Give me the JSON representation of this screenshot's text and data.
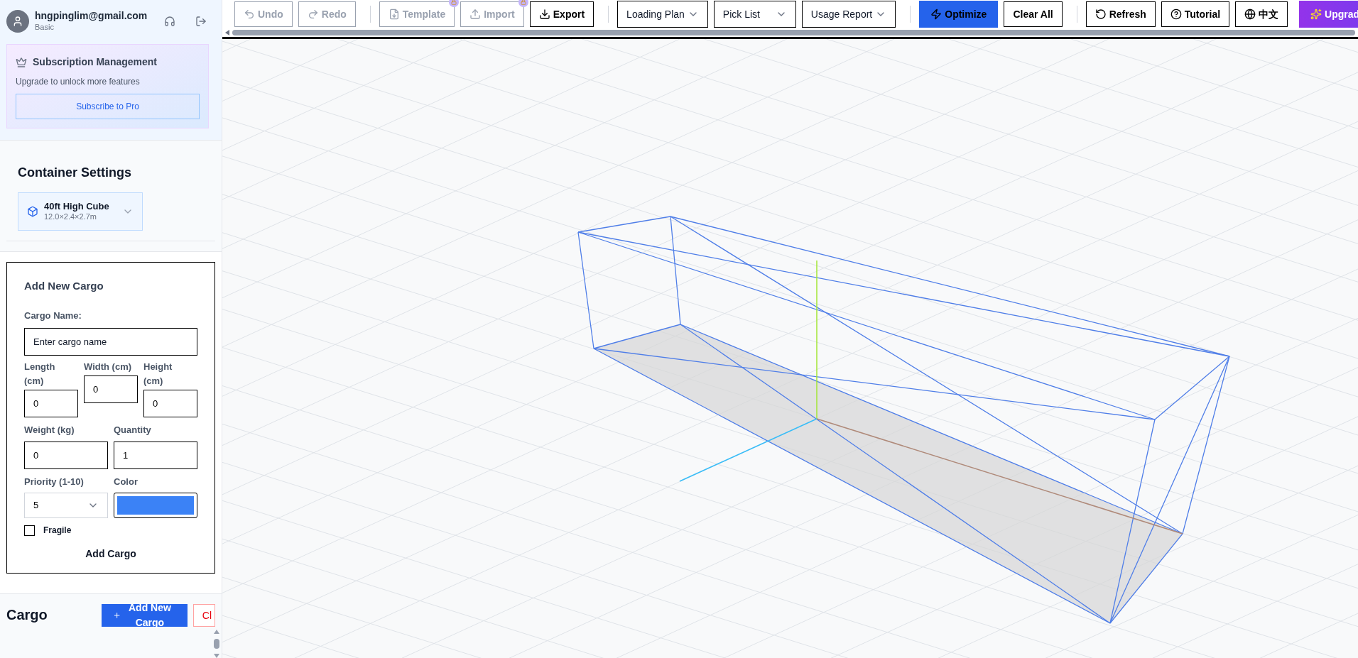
{
  "user": {
    "email": "hngpinglim@gmail.com",
    "plan": "Basic"
  },
  "subscription": {
    "title": "Subscription Management",
    "subtitle": "Upgrade to unlock more features",
    "button": "Subscribe to Pro"
  },
  "container_settings": {
    "title": "Container Settings",
    "selected_name": "40ft High Cube",
    "selected_dims": "12.0×2.4×2.7m"
  },
  "add_cargo": {
    "title": "Add New Cargo",
    "name_label": "Cargo Name:",
    "name_placeholder": "Enter cargo name",
    "dims": [
      {
        "label": "Length (cm)",
        "value": "0"
      },
      {
        "label": "Width (cm)",
        "value": "0"
      },
      {
        "label": "Height (cm)",
        "value": "0"
      }
    ],
    "weight": {
      "label": "Weight (kg)",
      "value": "0"
    },
    "quantity": {
      "label": "Quantity",
      "value": "1"
    },
    "priority": {
      "label": "Priority (1-10)",
      "value": "5"
    },
    "color": {
      "label": "Color",
      "color": "#3b82f6"
    },
    "fragile": {
      "label": "Fragile",
      "checked": false
    },
    "submit": "Add Cargo"
  },
  "cargo_section": {
    "title": "Cargo",
    "add_button": "Add New Cargo",
    "clear_button": "Cl"
  },
  "toolbar": [
    {
      "kind": "button",
      "label": "Undo",
      "disabled": true,
      "locked": false
    },
    {
      "kind": "button",
      "label": "Redo",
      "disabled": true,
      "locked": false
    },
    {
      "kind": "separator"
    },
    {
      "kind": "button",
      "label": "Template",
      "disabled": true,
      "locked": true
    },
    {
      "kind": "button",
      "label": "Import",
      "disabled": true,
      "locked": true
    },
    {
      "kind": "button",
      "label": "Export",
      "disabled": false,
      "locked": false
    },
    {
      "kind": "separator"
    },
    {
      "kind": "dropdown",
      "label": "Loading Plan"
    },
    {
      "kind": "dropdown",
      "label": "Pick List"
    },
    {
      "kind": "dropdown",
      "label": "Usage Report"
    },
    {
      "kind": "separator"
    },
    {
      "kind": "primary",
      "label": "Optimize"
    },
    {
      "kind": "button",
      "label": "Clear All",
      "disabled": false,
      "locked": false
    },
    {
      "kind": "separator"
    },
    {
      "kind": "button",
      "label": "Refresh",
      "disabled": false,
      "locked": false
    },
    {
      "kind": "button",
      "label": "Tutorial",
      "disabled": false,
      "locked": false
    },
    {
      "kind": "button",
      "label": "中文",
      "disabled": false,
      "locked": false
    },
    {
      "kind": "upgrade",
      "label": "Upgrad"
    }
  ]
}
